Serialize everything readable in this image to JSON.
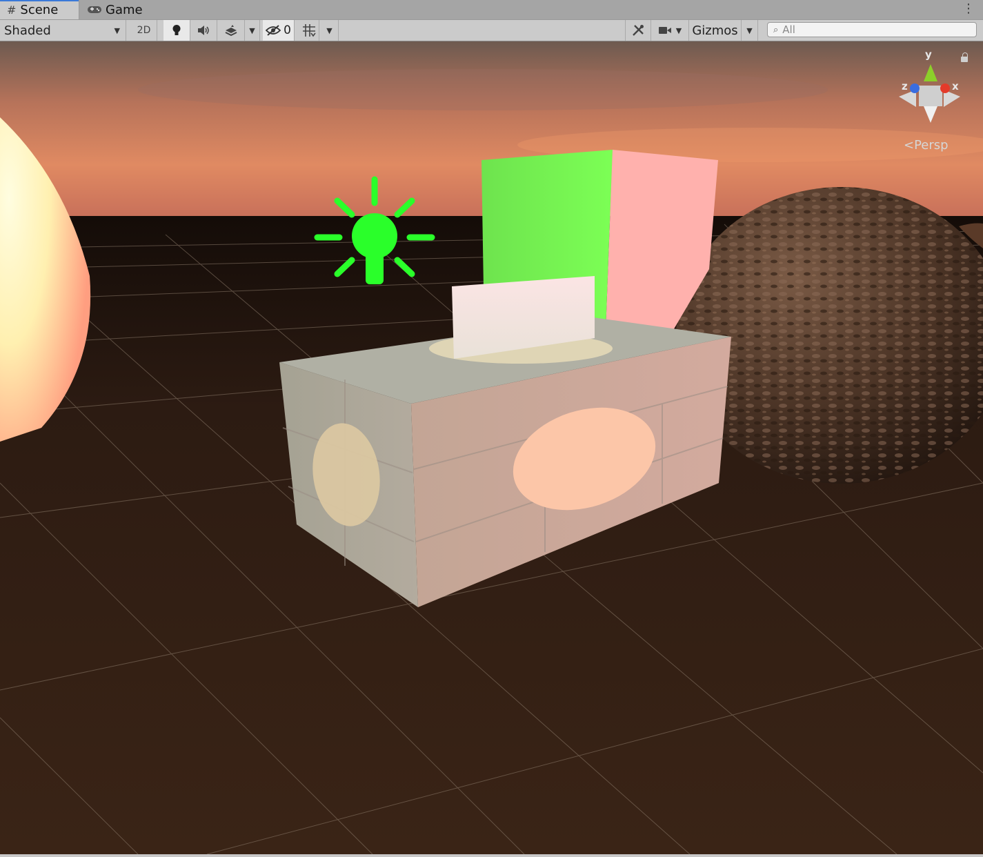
{
  "tabs": [
    {
      "label": "Scene",
      "icon": "grid-icon",
      "active": true
    },
    {
      "label": "Game",
      "icon": "gamepad-icon",
      "active": false
    }
  ],
  "toolbar": {
    "draw_mode": "Shaded",
    "mode_2d": "2D",
    "hidden_count": "0",
    "gizmos_label": "Gizmos",
    "search_placeholder": "All",
    "icons": [
      "lightbulb-icon",
      "audio-icon",
      "effects-layers-icon",
      "visibility-icon",
      "grid-snap-icon",
      "tools-icon",
      "camera-icon",
      "search-icon"
    ]
  },
  "scene": {
    "projection_label": "Persp",
    "gizmo_axes": {
      "x": "x",
      "y": "y",
      "z": "z"
    },
    "colors": {
      "sky_top": "#7a6050",
      "sky_horizon": "#e0855e",
      "ground": "#2a1a12",
      "light_icon": "#2aff2a",
      "cube_green": "#78f554",
      "cube_pink": "#ffb1ad",
      "axis_x": "#e43a2a",
      "axis_y": "#8ccf2a",
      "axis_z": "#3a6de0"
    }
  }
}
